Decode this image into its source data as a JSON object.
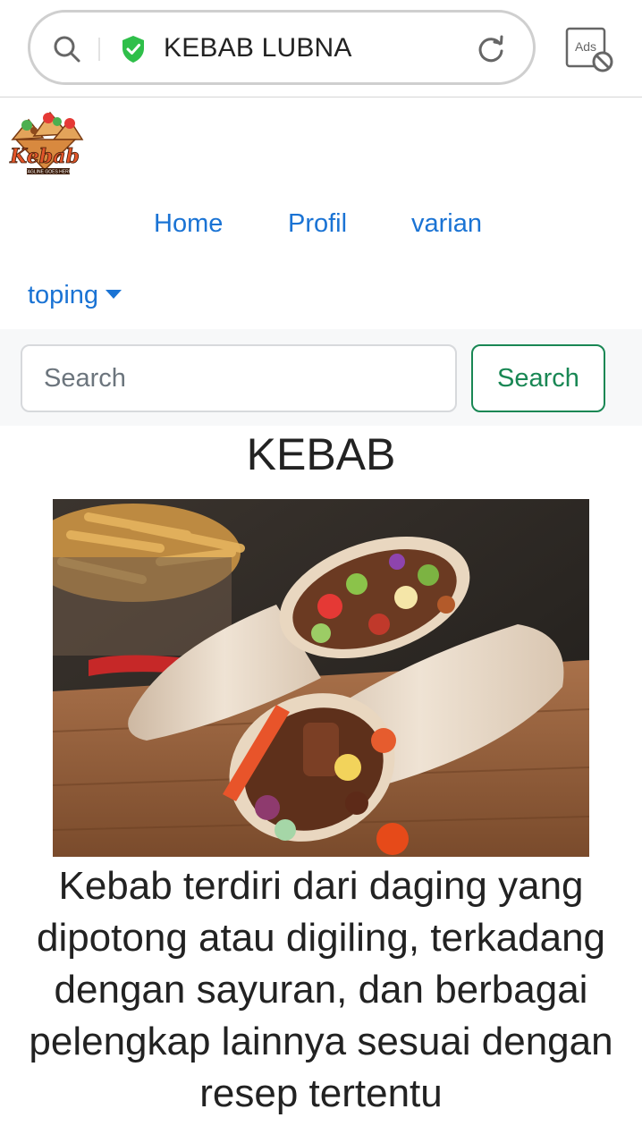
{
  "browser": {
    "address_title": "KEBAB LUBNA",
    "ads_label": "Ads",
    "icons": [
      "search-icon",
      "shield-check-icon",
      "reload-icon",
      "ads-block-icon"
    ]
  },
  "site": {
    "logo_text": "Kebab",
    "logo_tagline": "TAGLINE GOES HERE"
  },
  "nav": {
    "home": "Home",
    "profil": "Profil",
    "varian": "varian",
    "toping": "toping"
  },
  "search": {
    "placeholder": "Search",
    "value": "",
    "button_label": "Search"
  },
  "content": {
    "heading": "KEBAB",
    "description": "Kebab terdiri dari daging yang dipotong atau digiling, terkadang dengan sayuran, dan berbagai pelengkap lainnya sesuai dengan resep tertentu"
  },
  "colors": {
    "link": "#1a73d4",
    "success": "#198754",
    "shield": "#2fbf4a",
    "search_band": "#f7f8f9"
  }
}
